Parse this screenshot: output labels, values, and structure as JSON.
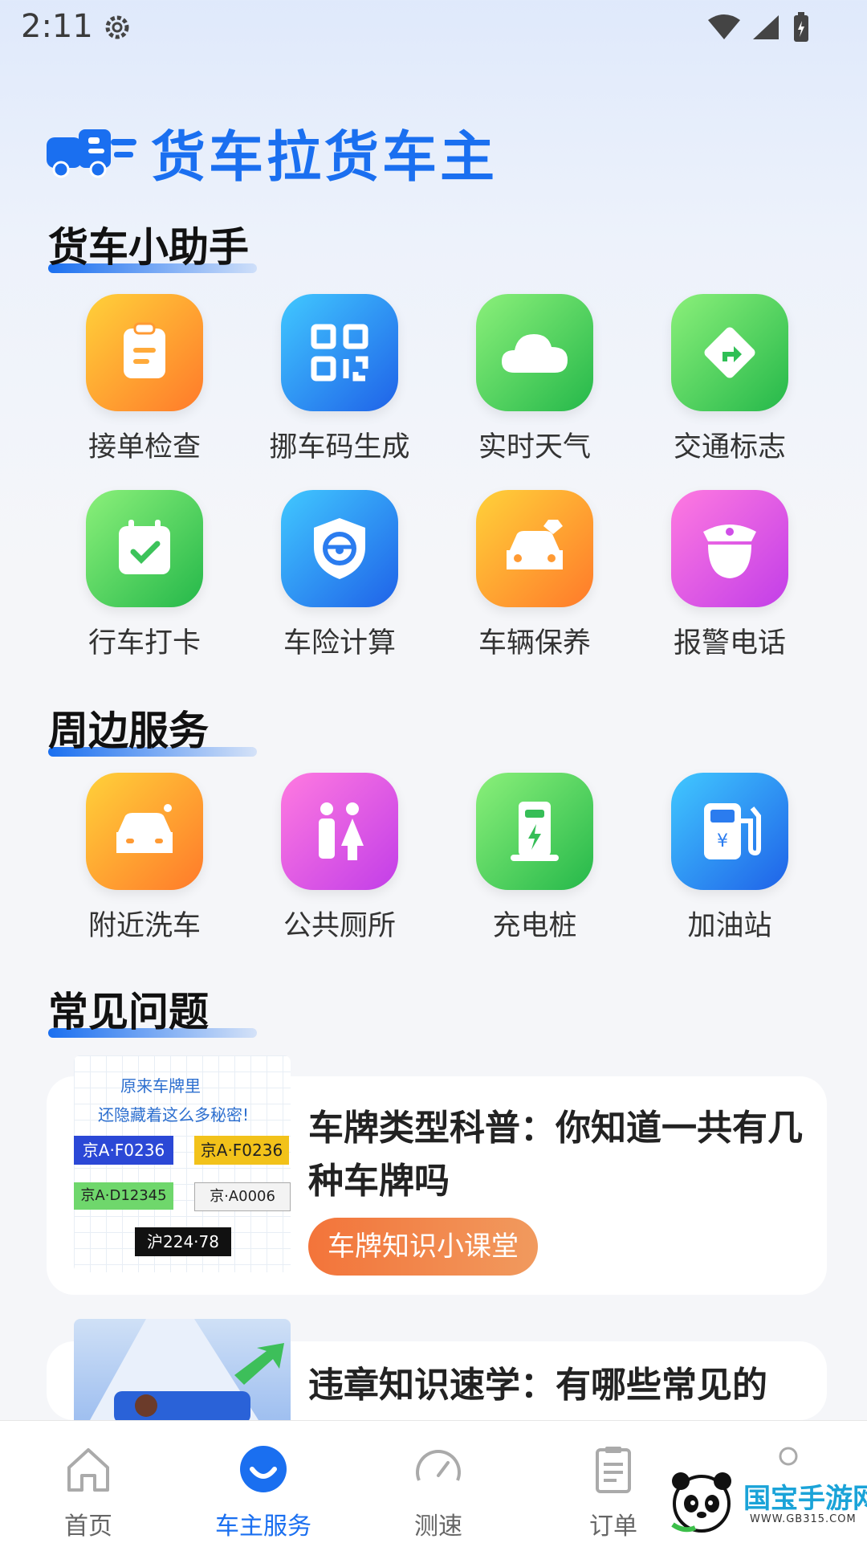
{
  "status_bar": {
    "time": "2:11"
  },
  "brand": {
    "title": "货车拉货车主"
  },
  "sections": {
    "helper_title": "货车小助手",
    "nearby_title": "周边服务",
    "faq_title": "常见问题"
  },
  "helper_items": [
    {
      "label": "接单检查",
      "icon": "clipboard-icon"
    },
    {
      "label": "挪车码生成",
      "icon": "qr-code-icon"
    },
    {
      "label": "实时天气",
      "icon": "cloud-icon"
    },
    {
      "label": "交通标志",
      "icon": "turn-sign-icon"
    },
    {
      "label": "行车打卡",
      "icon": "calendar-check-icon"
    },
    {
      "label": "车险计算",
      "icon": "shield-steering-icon"
    },
    {
      "label": "车辆保养",
      "icon": "car-care-icon"
    },
    {
      "label": "报警电话",
      "icon": "police-icon"
    }
  ],
  "nearby_items": [
    {
      "label": "附近洗车",
      "icon": "car-wash-icon"
    },
    {
      "label": "公共厕所",
      "icon": "restroom-icon"
    },
    {
      "label": "充电桩",
      "icon": "charging-station-icon"
    },
    {
      "label": "加油站",
      "icon": "gas-station-icon"
    }
  ],
  "faq": [
    {
      "title": "车牌类型科普：你知道一共有几种车牌吗",
      "tag": "车牌知识小课堂",
      "image_text": {
        "line1": "原来车牌里",
        "line2": "还隐藏着这么多秘密!",
        "plates": [
          "京A·F0236",
          "京A·F0236",
          "京A·D12345",
          "京·A0006",
          "沪224·78"
        ]
      }
    },
    {
      "title": "违章知识速学：有哪些常见的"
    }
  ],
  "tabs": [
    {
      "label": "首页",
      "icon": "home-icon"
    },
    {
      "label": "车主服务",
      "icon": "smile-icon"
    },
    {
      "label": "测速",
      "icon": "speedometer-icon"
    },
    {
      "label": "订单",
      "icon": "order-icon"
    }
  ],
  "watermark": {
    "name": "国宝手游网",
    "url": "WWW.GB315.COM"
  },
  "colors": {
    "accent": "#1a6ff0",
    "tag": "#f3743a"
  }
}
